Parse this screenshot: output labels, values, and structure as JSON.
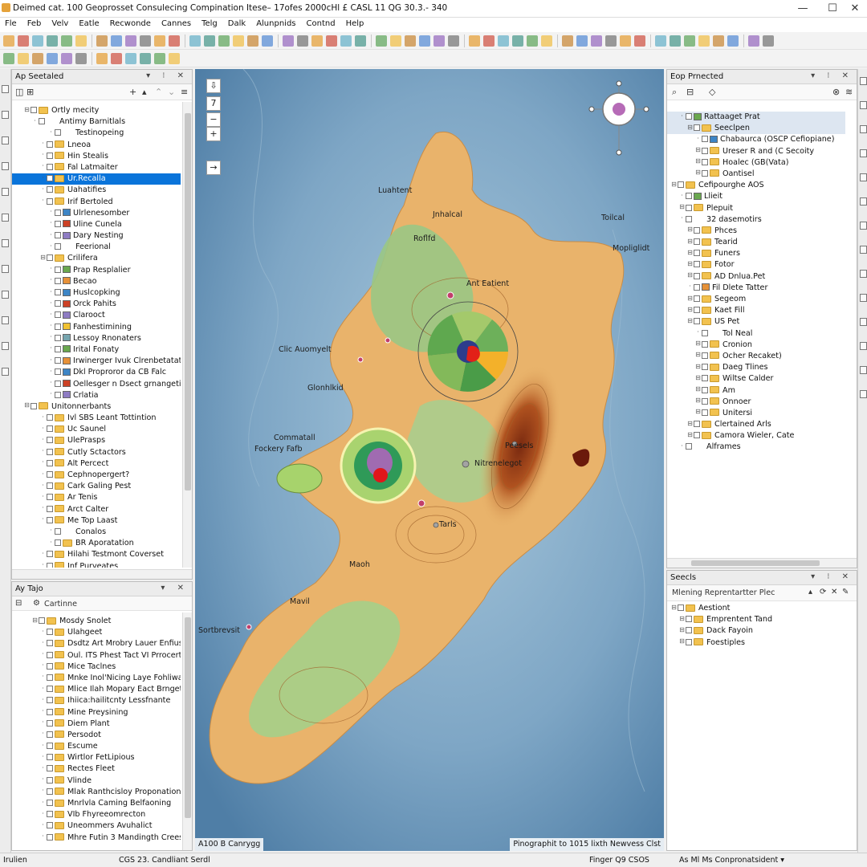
{
  "window": {
    "title": "Deimed cat. 100 Geoprosset Consulecing Compination Itese– 17ofes 2000cHl £ CASL 11 QG 30.3.- 340",
    "minimize": "—",
    "maximize": "☐",
    "close": "✕"
  },
  "menu": [
    "Fle",
    "Feb",
    "Velv",
    "Eatle",
    "Recwonde",
    "Cannes",
    "Telg",
    "Dalk",
    "Alunpnids",
    "Contnd",
    "Help"
  ],
  "left_panel_top": {
    "title": "Ap Seetaled",
    "items": [
      {
        "label": "Ortly mecity",
        "indent": 1,
        "kind": "folder"
      },
      {
        "label": "Antimy Barnitlals",
        "indent": 2,
        "kind": "plain"
      },
      {
        "label": "Testinopeing",
        "indent": 4,
        "kind": "plain"
      },
      {
        "label": "Lneoa",
        "indent": 3,
        "kind": "layer"
      },
      {
        "label": "Hin Stealis",
        "indent": 3,
        "kind": "layer"
      },
      {
        "label": "Fal Latmaiter",
        "indent": 3,
        "kind": "layer"
      },
      {
        "label": "Ur.Recalla",
        "indent": 3,
        "kind": "layer",
        "selected": true
      },
      {
        "label": "Uahatifies",
        "indent": 3,
        "kind": "layer"
      },
      {
        "label": "Irif Bertoled",
        "indent": 3,
        "kind": "layer"
      },
      {
        "label": "Ulrlenesomber",
        "indent": 4,
        "kind": "sym"
      },
      {
        "label": "Uline Cunela",
        "indent": 4,
        "kind": "sym"
      },
      {
        "label": "Dary Nesting",
        "indent": 4,
        "kind": "sym"
      },
      {
        "label": "Feerional",
        "indent": 4,
        "kind": "plain"
      },
      {
        "label": "Crilifera",
        "indent": 3,
        "kind": "folder"
      },
      {
        "label": "Prap Resplalier",
        "indent": 4,
        "kind": "sym"
      },
      {
        "label": "Becao",
        "indent": 4,
        "kind": "sym"
      },
      {
        "label": "Huslcopking",
        "indent": 4,
        "kind": "sym"
      },
      {
        "label": "Orck Pahits",
        "indent": 4,
        "kind": "sym"
      },
      {
        "label": "Clarooct",
        "indent": 4,
        "kind": "sym"
      },
      {
        "label": "Fanhestimining",
        "indent": 4,
        "kind": "sym"
      },
      {
        "label": "Lessoy Rnonaters",
        "indent": 4,
        "kind": "sym"
      },
      {
        "label": "Irital Fonaty",
        "indent": 4,
        "kind": "sym"
      },
      {
        "label": "Irwinerger Ivuk Clrenbetatation",
        "indent": 4,
        "kind": "sym"
      },
      {
        "label": "Dkl Proproror da CB Falc",
        "indent": 4,
        "kind": "sym"
      },
      {
        "label": "Oellesger n Dsect grnangetion",
        "indent": 4,
        "kind": "sym"
      },
      {
        "label": "Crlatia",
        "indent": 4,
        "kind": "sym"
      },
      {
        "label": "Unitonnerbants",
        "indent": 1,
        "kind": "folder"
      },
      {
        "label": "Ivl SBS Leant Tottintion",
        "indent": 3,
        "kind": "layer"
      },
      {
        "label": "Uc Saunel",
        "indent": 3,
        "kind": "layer"
      },
      {
        "label": "UlePrasps",
        "indent": 3,
        "kind": "layer"
      },
      {
        "label": "Cutly Sctactors",
        "indent": 3,
        "kind": "layer"
      },
      {
        "label": "Alt Percect",
        "indent": 3,
        "kind": "layer"
      },
      {
        "label": "Cephnopergert?",
        "indent": 3,
        "kind": "layer"
      },
      {
        "label": "Cark Galing Pest",
        "indent": 3,
        "kind": "layer"
      },
      {
        "label": "Ar Tenis",
        "indent": 3,
        "kind": "layer"
      },
      {
        "label": "Arct Calter",
        "indent": 3,
        "kind": "layer"
      },
      {
        "label": "Me Top Laast",
        "indent": 3,
        "kind": "layer"
      },
      {
        "label": "Conalos",
        "indent": 4,
        "kind": "plain"
      },
      {
        "label": "BR Aporatation",
        "indent": 4,
        "kind": "layer"
      },
      {
        "label": "Hilahi Testmont Coverset",
        "indent": 3,
        "kind": "layer"
      },
      {
        "label": "Inf Purveates",
        "indent": 3,
        "kind": "layer"
      }
    ]
  },
  "left_panel_bottom": {
    "title": "Ay Tajo",
    "root": "Cartinne",
    "items": [
      {
        "label": "Mosdy Snolet",
        "indent": 2,
        "kind": "folder"
      },
      {
        "label": "Ulahgeet",
        "indent": 3,
        "kind": "layer"
      },
      {
        "label": "Dsdtz Art Mrobry Lauer Enfiusd",
        "indent": 3,
        "kind": "layer"
      },
      {
        "label": "Oul. ITS Phest Tact VI Prrocertet",
        "indent": 3,
        "kind": "layer"
      },
      {
        "label": "Mice Taclnes",
        "indent": 3,
        "kind": "layer"
      },
      {
        "label": "Mnke Inol'Nicing Laye Fohliwalte",
        "indent": 3,
        "kind": "layer"
      },
      {
        "label": "Mlice Ilah Mopary Eact Brngeth",
        "indent": 3,
        "kind": "layer"
      },
      {
        "label": "Ihiica:hailitcnty Lessfnante",
        "indent": 3,
        "kind": "layer"
      },
      {
        "label": "Mine Preysining",
        "indent": 3,
        "kind": "layer"
      },
      {
        "label": "Diem Plant",
        "indent": 3,
        "kind": "layer"
      },
      {
        "label": "Persodot",
        "indent": 3,
        "kind": "layer"
      },
      {
        "label": "Escume",
        "indent": 3,
        "kind": "layer"
      },
      {
        "label": "Wirtlor FetLipious",
        "indent": 3,
        "kind": "layer"
      },
      {
        "label": "Rectes Fleet",
        "indent": 3,
        "kind": "layer"
      },
      {
        "label": "Vlinde",
        "indent": 3,
        "kind": "layer"
      },
      {
        "label": "Mlak Ranthcisloy Proponation",
        "indent": 3,
        "kind": "layer"
      },
      {
        "label": "Mnrlvla Caming Belfaoning",
        "indent": 3,
        "kind": "layer"
      },
      {
        "label": "VIb Fhyreeomrecton",
        "indent": 3,
        "kind": "layer"
      },
      {
        "label": "Uneommers Avuhalict",
        "indent": 3,
        "kind": "layer"
      },
      {
        "label": "Mhre Futin 3 Mandingth Creese",
        "indent": 3,
        "kind": "layer"
      }
    ]
  },
  "right_panel_top": {
    "title": "Eop Prnected",
    "items": [
      {
        "label": "Rattaaget Prat",
        "indent": 1,
        "kind": "sym",
        "highlight": true
      },
      {
        "label": "Seeclpen",
        "indent": 2,
        "kind": "folder",
        "highlight": true
      },
      {
        "label": "Chabaurca (OSCP Cefiopiane)",
        "indent": 3,
        "kind": "sym"
      },
      {
        "label": "Ureser R and (C Secoity",
        "indent": 3,
        "kind": "folder"
      },
      {
        "label": "Hoalec (GB(Vata)",
        "indent": 3,
        "kind": "folder"
      },
      {
        "label": "Oantisel",
        "indent": 3,
        "kind": "folder"
      },
      {
        "label": "Cefipourghe AOS",
        "indent": 0,
        "kind": "folder"
      },
      {
        "label": "Llieit",
        "indent": 1,
        "kind": "sym"
      },
      {
        "label": "Plepuit",
        "indent": 1,
        "kind": "folder"
      },
      {
        "label": "32 dasemotirs",
        "indent": 1,
        "kind": "plain"
      },
      {
        "label": "Phces",
        "indent": 2,
        "kind": "folder"
      },
      {
        "label": "Tearid",
        "indent": 2,
        "kind": "folder"
      },
      {
        "label": "Funers",
        "indent": 2,
        "kind": "folder"
      },
      {
        "label": "Fotor",
        "indent": 2,
        "kind": "folder"
      },
      {
        "label": "AD Dnlua.Pet",
        "indent": 2,
        "kind": "folder"
      },
      {
        "label": "Fil Dlete Tatter",
        "indent": 2,
        "kind": "sym"
      },
      {
        "label": "Segeom",
        "indent": 2,
        "kind": "folder"
      },
      {
        "label": "Kaet Fill",
        "indent": 2,
        "kind": "folder"
      },
      {
        "label": "US Pet",
        "indent": 2,
        "kind": "folder"
      },
      {
        "label": "Tol Neal",
        "indent": 3,
        "kind": "plain"
      },
      {
        "label": "Cronion",
        "indent": 3,
        "kind": "folder"
      },
      {
        "label": "Ocher Recaket)",
        "indent": 3,
        "kind": "folder"
      },
      {
        "label": "Daeg Tlines",
        "indent": 3,
        "kind": "folder"
      },
      {
        "label": "Wiltse Calder",
        "indent": 3,
        "kind": "folder"
      },
      {
        "label": "Am",
        "indent": 3,
        "kind": "folder"
      },
      {
        "label": "Onnoer",
        "indent": 3,
        "kind": "folder"
      },
      {
        "label": "Unitersi",
        "indent": 3,
        "kind": "folder"
      },
      {
        "label": "Clertained Arls",
        "indent": 2,
        "kind": "folder"
      },
      {
        "label": "Camora Wieler, Cate",
        "indent": 2,
        "kind": "folder"
      },
      {
        "label": "Alframes",
        "indent": 1,
        "kind": "plain"
      }
    ]
  },
  "right_panel_bottom": {
    "title": "Seecls",
    "subheader": "Mlening Reprentartter Plec",
    "items": [
      {
        "label": "Aestiont",
        "indent": 0,
        "kind": "folder"
      },
      {
        "label": "Emprentent Tand",
        "indent": 1,
        "kind": "folder"
      },
      {
        "label": "Dack Fayoin",
        "indent": 1,
        "kind": "folder"
      },
      {
        "label": "Foestiples",
        "indent": 1,
        "kind": "folder"
      }
    ]
  },
  "map": {
    "labels": [
      "Luahtent",
      "Jnhalcal",
      "Toilcal",
      "Roflfd",
      "Mopliglidt",
      "Ant Eatient",
      "Clic Auomyelt",
      "Glonhlkid",
      "Commatall",
      "Fockery Fafb",
      "Peesels",
      "Nitrenelegot",
      "Tarls",
      "Maoh",
      "Mavil",
      "Sortbrevsit"
    ],
    "scale_text": "A100 B Canrygg",
    "attribution": "Pinographit to 1015 lixth Newvess Clst"
  },
  "status": {
    "left": "Irulien",
    "center": "CGS 23. Candliant Serdl",
    "coords": "Finger Q9 CSOS",
    "right": "As Ml Ms Conpronatsident ▾"
  },
  "colors": {
    "selected": "#0a74da",
    "folder": "#f2c24f",
    "water": "#7ea6c5",
    "land_low": "#8fc07a",
    "land_mid": "#e8b46a",
    "land_high": "#b0521f"
  }
}
